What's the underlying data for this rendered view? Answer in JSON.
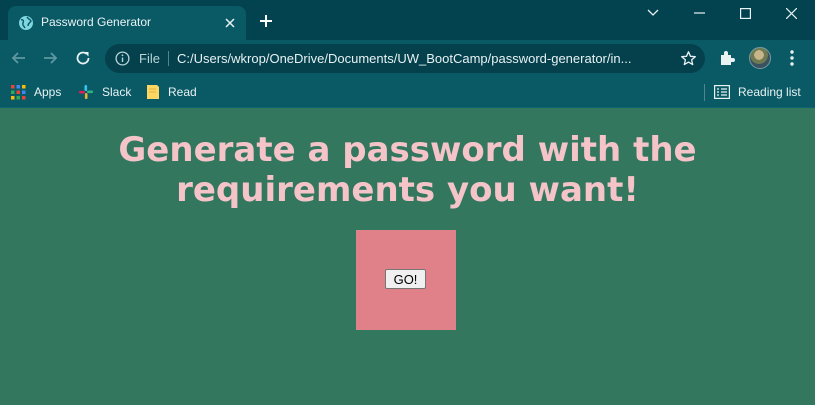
{
  "browser": {
    "tab": {
      "title": "Password Generator"
    },
    "address": {
      "scheme": "File",
      "url": "C:/Users/wkrop/OneDrive/Documents/UW_BootCamp/password-generator/in..."
    },
    "bookmarks": [
      {
        "label": "Apps",
        "icon": "apps-grid-icon"
      },
      {
        "label": "Slack",
        "icon": "slack-icon"
      },
      {
        "label": "Read",
        "icon": "bookmark-folder-icon"
      }
    ],
    "reading_list": {
      "label": "Reading list",
      "icon": "reading-list-icon"
    }
  },
  "page": {
    "headline": "Generate a password with the requirements you want!",
    "go_button_label": "GO!",
    "colors": {
      "background": "#33775f",
      "headline": "#f4c4c9",
      "box": "#e0818a"
    }
  }
}
